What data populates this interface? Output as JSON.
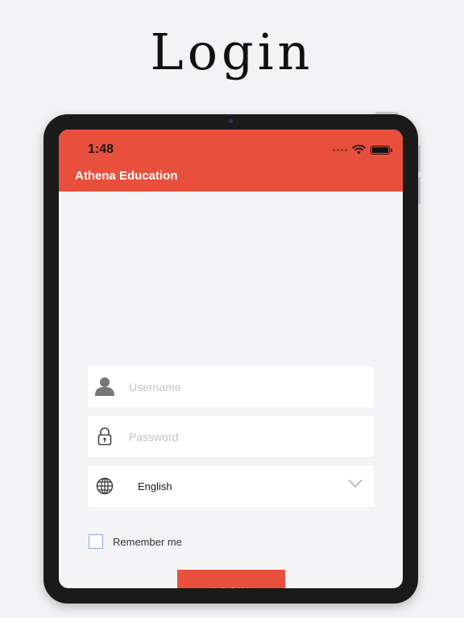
{
  "promo": {
    "title": "Login"
  },
  "status_bar": {
    "time": "1:48",
    "icons": [
      "signal-icon",
      "wifi-icon",
      "battery-icon"
    ],
    "battery_level": 1.0
  },
  "app_bar": {
    "title": "Athena Education",
    "color": "#e8503d"
  },
  "form": {
    "username": {
      "placeholder": "Username",
      "value": "",
      "icon": "user-icon"
    },
    "password": {
      "placeholder": "Password",
      "value": "",
      "icon": "lock-icon"
    },
    "language": {
      "value": "English",
      "icon": "globe-icon",
      "dropdown_icon": "chevron-down-icon"
    },
    "remember_me": {
      "label": "Remember me",
      "checked": false
    },
    "login_button": {
      "label": "LOGIN"
    }
  },
  "colors": {
    "accent": "#e8503d",
    "screen_bg": "#f4f4f6",
    "device": "#1a1a1a"
  }
}
